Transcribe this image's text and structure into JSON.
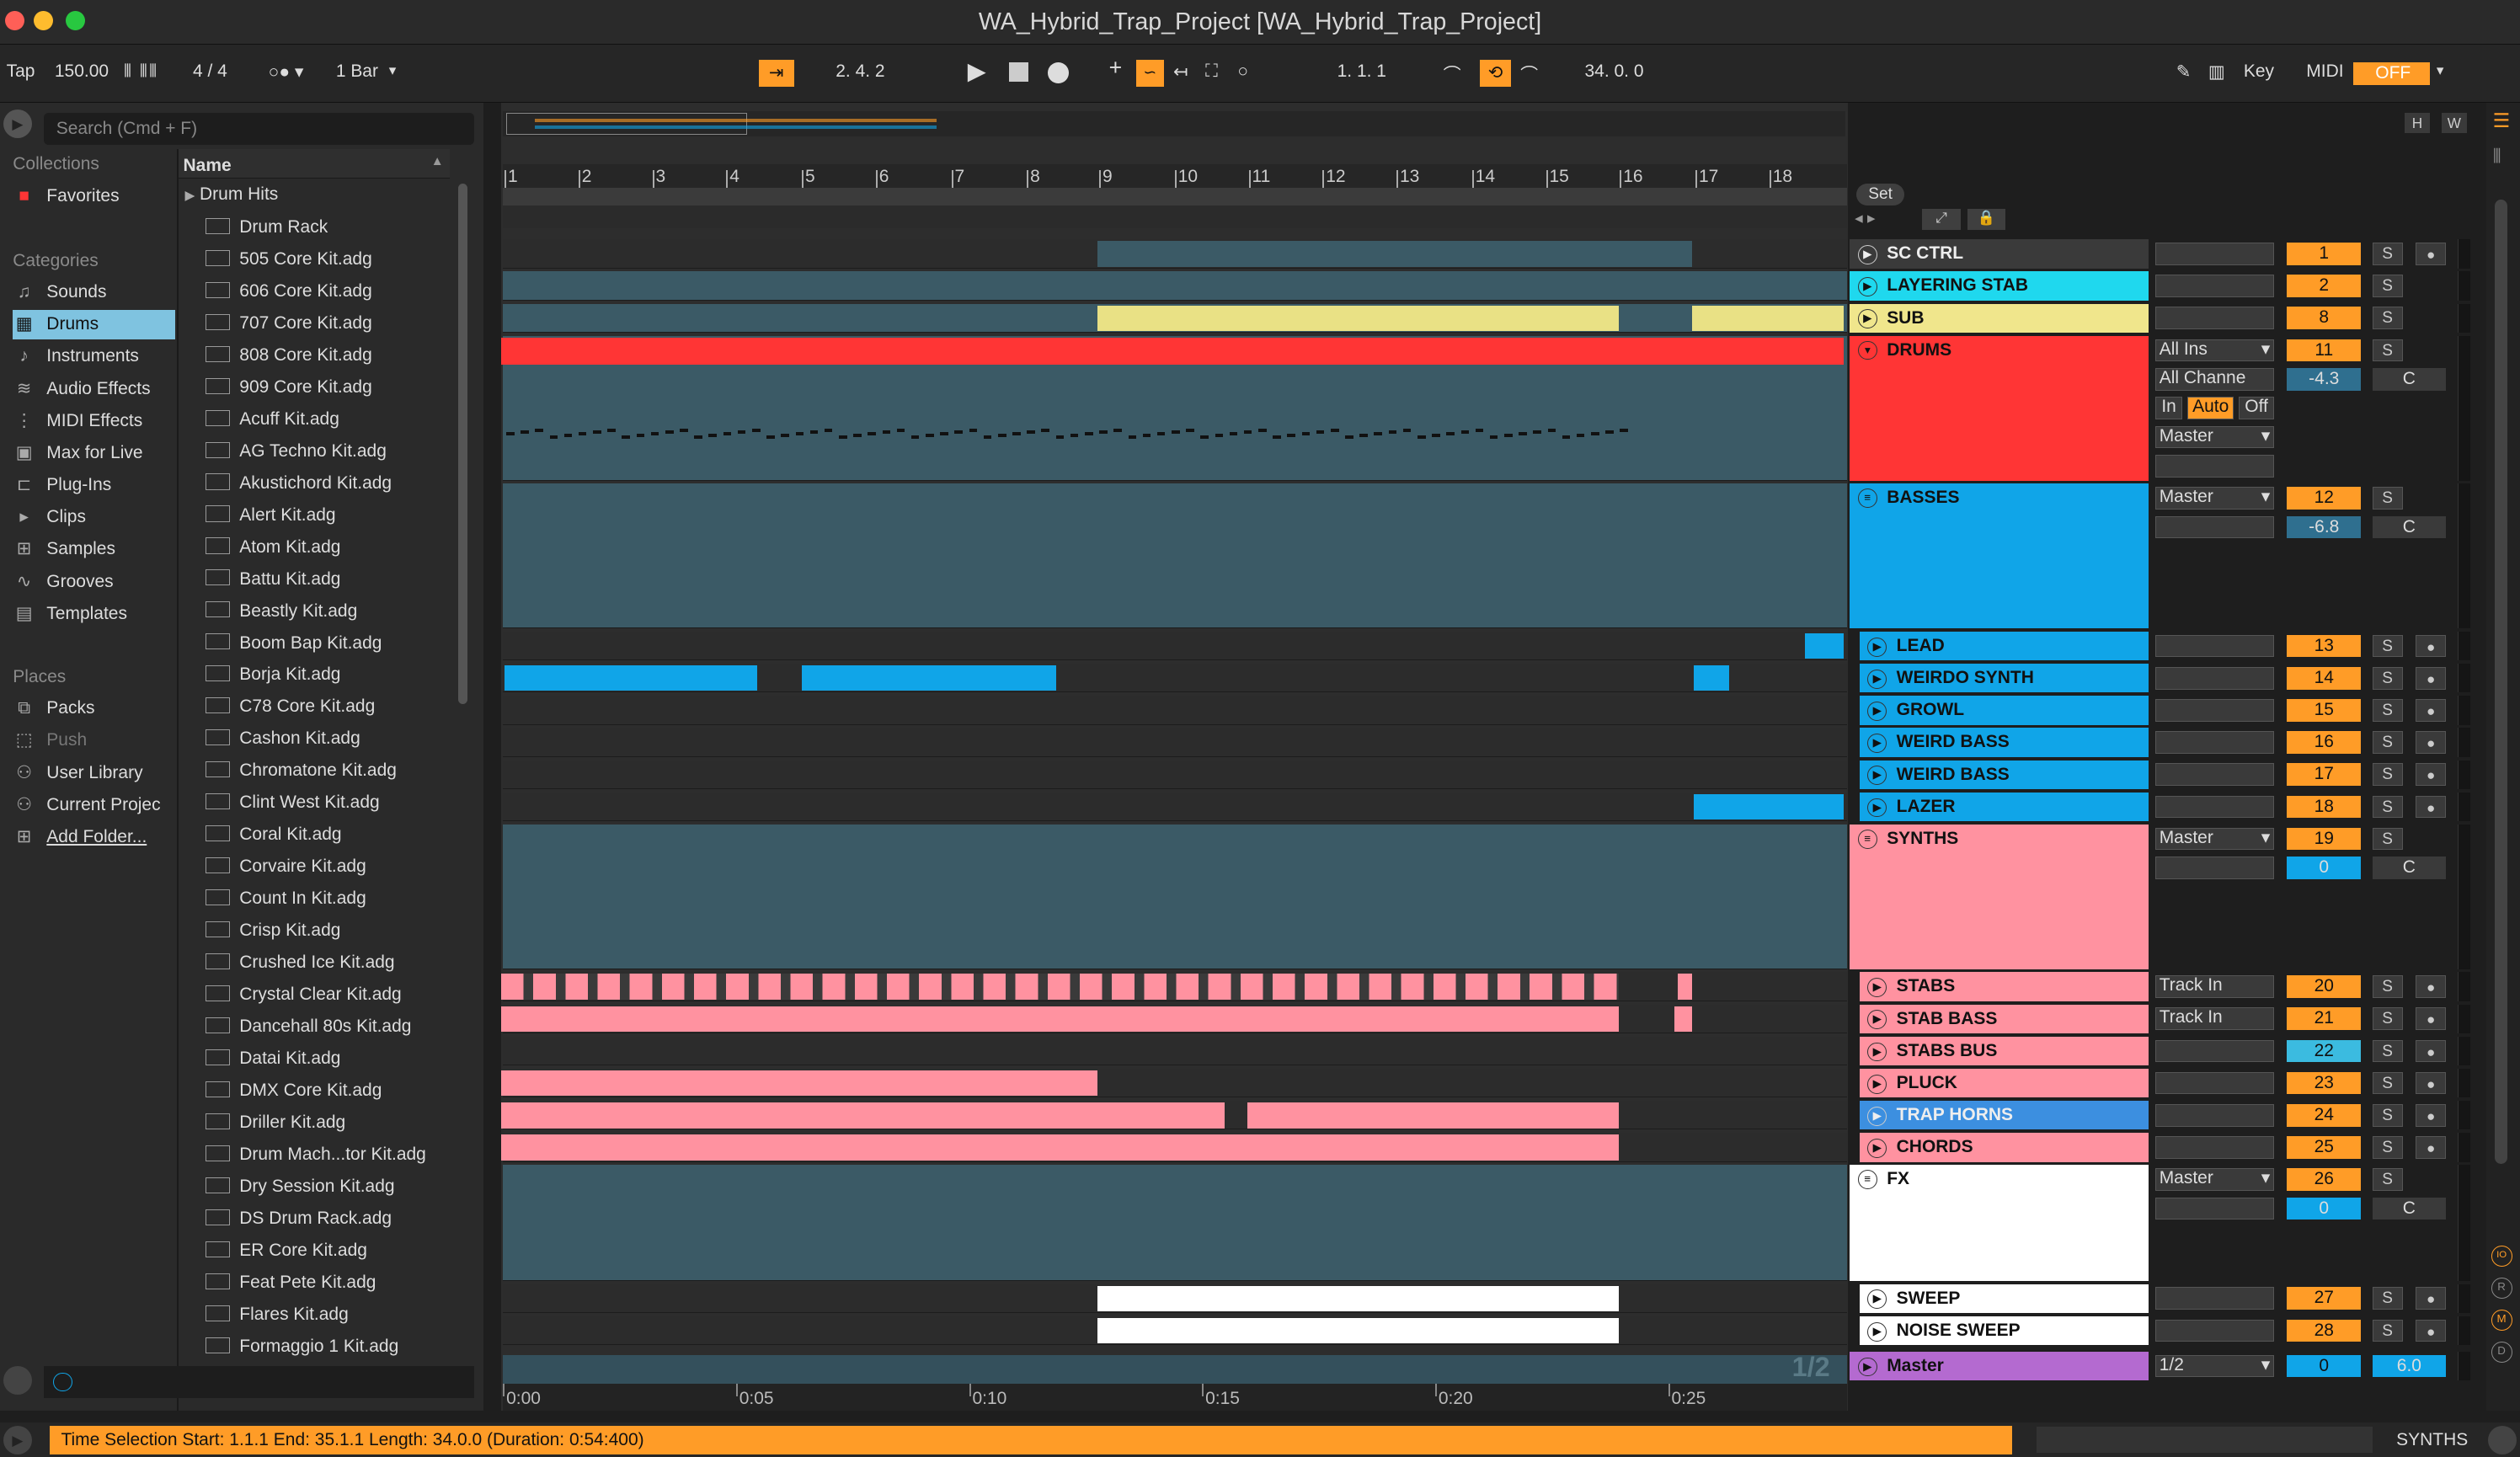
{
  "window": {
    "title": "WA_Hybrid_Trap_Project  [WA_Hybrid_Trap_Project]"
  },
  "control": {
    "tap": "Tap",
    "tempo": "150.00",
    "sig": "4 / 4",
    "quant": "1 Bar",
    "arr_pos": "2.   4.   2",
    "loop_start": "1.   1.   1",
    "loop_len": "34.   0.   0",
    "key": "Key",
    "midi": "MIDI",
    "off": "OFF"
  },
  "browser": {
    "search_placeholder": "Search (Cmd + F)",
    "collections_head": "Collections",
    "favorites": "Favorites",
    "categories_head": "Categories",
    "categories": [
      "Sounds",
      "Drums",
      "Instruments",
      "Audio Effects",
      "MIDI Effects",
      "Max for Live",
      "Plug-Ins",
      "Clips",
      "Samples",
      "Grooves",
      "Templates"
    ],
    "places_head": "Places",
    "places": [
      "Packs",
      "Push",
      "User Library",
      "Current Projec",
      "Add Folder..."
    ],
    "name_head": "Name",
    "folder": "Drum Hits",
    "items": [
      "Drum Rack",
      "505 Core Kit.adg",
      "606 Core Kit.adg",
      "707 Core Kit.adg",
      "808 Core Kit.adg",
      "909 Core Kit.adg",
      "Acuff Kit.adg",
      "AG Techno Kit.adg",
      "Akustichord Kit.adg",
      "Alert Kit.adg",
      "Atom Kit.adg",
      "Battu Kit.adg",
      "Beastly Kit.adg",
      "Boom Bap Kit.adg",
      "Borja Kit.adg",
      "C78 Core Kit.adg",
      "Cashon Kit.adg",
      "Chromatone Kit.adg",
      "Clint West Kit.adg",
      "Coral Kit.adg",
      "Corvaire Kit.adg",
      "Count In Kit.adg",
      "Crisp Kit.adg",
      "Crushed Ice Kit.adg",
      "Crystal Clear Kit.adg",
      "Dancehall 80s Kit.adg",
      "Datai Kit.adg",
      "DMX Core Kit.adg",
      "Driller Kit.adg",
      "Drum Mach...tor Kit.adg",
      "Dry Session Kit.adg",
      "DS Drum Rack.adg",
      "ER Core Kit.adg",
      "Feat Pete Kit.adg",
      "Flares Kit.adg",
      "Formaggio 1 Kit.adg"
    ]
  },
  "ruler": {
    "bars": [
      "1",
      "2",
      "3",
      "4",
      "5",
      "6",
      "7",
      "8",
      "9",
      "10",
      "11",
      "12",
      "13",
      "14",
      "15",
      "16",
      "17",
      "18"
    ],
    "set": "Set",
    "times": [
      "0:00",
      "0:05",
      "0:10",
      "0:15",
      "0:20",
      "0:25"
    ],
    "page": "1/2"
  },
  "tracks": [
    {
      "name": "SC CTRL",
      "num": "1",
      "color": "#3a3a3a"
    },
    {
      "name": "LAYERING STAB",
      "num": "2",
      "color": "#1fd8ee"
    },
    {
      "name": "SUB",
      "num": "8",
      "color": "#f0e68c"
    },
    {
      "name": "DRUMS",
      "num": "11",
      "color": "#ff3535",
      "route": "All Ins",
      "chan": "All Channe",
      "vol": "-4.3",
      "pan": "C",
      "out": "Master",
      "mon_in": "In",
      "mon_auto": "Auto",
      "mon_off": "Off"
    },
    {
      "name": "BASSES",
      "num": "12",
      "color": "#10a5e8",
      "out": "Master",
      "vol": "-6.8",
      "pan": "C"
    },
    {
      "name": "LEAD",
      "num": "13",
      "color": "#10a5e8"
    },
    {
      "name": "WEIRDO SYNTH",
      "num": "14",
      "color": "#10a5e8"
    },
    {
      "name": "GROWL",
      "num": "15",
      "color": "#10a5e8"
    },
    {
      "name": "WEIRD BASS",
      "num": "16",
      "color": "#10a5e8"
    },
    {
      "name": "WEIRD BASS",
      "num": "17",
      "color": "#10a5e8"
    },
    {
      "name": "LAZER",
      "num": "18",
      "color": "#10a5e8"
    },
    {
      "name": "SYNTHS",
      "num": "19",
      "color": "#ff92a0",
      "out": "Master",
      "vol": "0",
      "pan": "C"
    },
    {
      "name": "STABS",
      "num": "20",
      "color": "#ff92a0",
      "route": "Track In"
    },
    {
      "name": "STAB BASS",
      "num": "21",
      "color": "#ff92a0",
      "route": "Track In"
    },
    {
      "name": "STABS BUS",
      "num": "22",
      "color": "#ff92a0"
    },
    {
      "name": "PLUCK",
      "num": "23",
      "color": "#ff92a0"
    },
    {
      "name": "TRAP HORNS",
      "num": "24",
      "color": "#3c8fe0"
    },
    {
      "name": "CHORDS",
      "num": "25",
      "color": "#ff92a0"
    },
    {
      "name": "FX",
      "num": "26",
      "color": "#ffffff",
      "out": "Master",
      "vol": "0",
      "pan": "C"
    },
    {
      "name": "SWEEP",
      "num": "27",
      "color": "#ffffff"
    },
    {
      "name": "NOISE SWEEP",
      "num": "28",
      "color": "#ffffff"
    },
    {
      "name": "Master",
      "num": "0",
      "color": "#b46ad0",
      "out": "1/2",
      "vol": "6.0"
    }
  ],
  "mixer": {
    "solo": "S"
  },
  "status": {
    "text": "Time Selection   Start: 1.1.1    End: 35.1.1    Length: 34.0.0  (Duration: 0:54:400)",
    "track": "SYNTHS"
  },
  "colors": {
    "accent": "#ff9c27",
    "drums": "#ff3535",
    "basses": "#10a5e8",
    "synths": "#ff92a0"
  }
}
